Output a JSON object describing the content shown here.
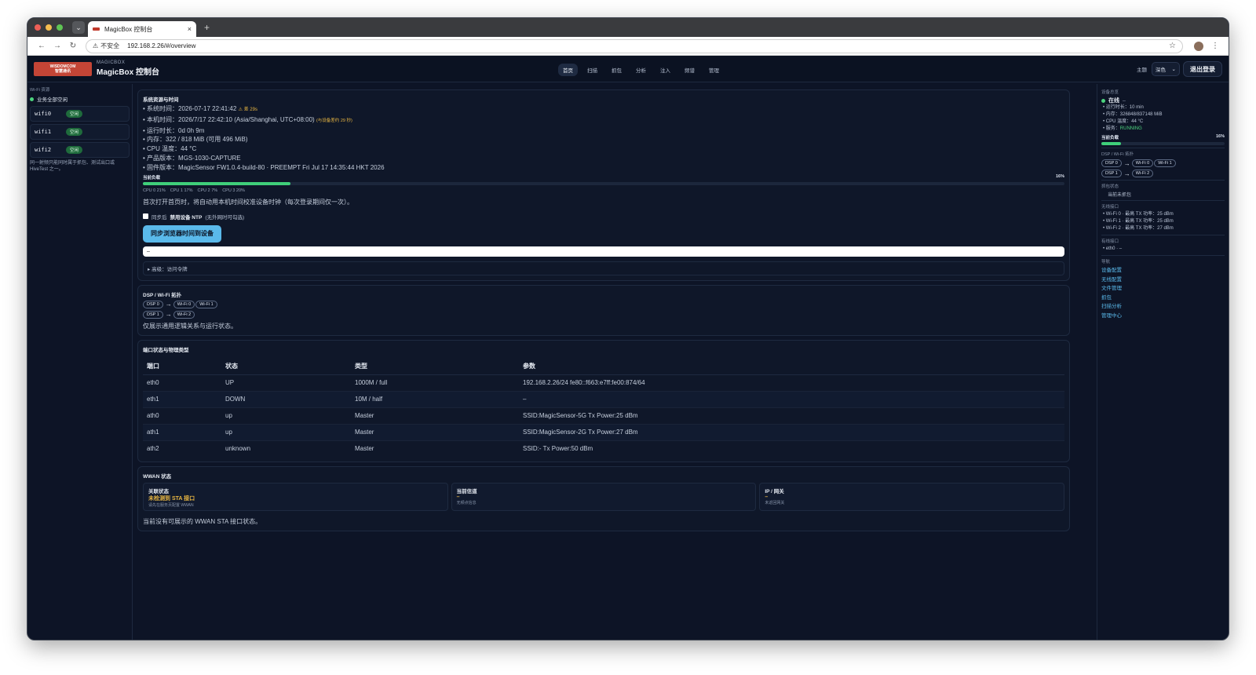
{
  "browser": {
    "tab_title": "MagicBox 控制台",
    "tab_close": "×",
    "new_tab": "+",
    "insecure_label": "不安全",
    "url": "192.168.2.26/#/overview"
  },
  "header": {
    "logo_text_1": "WISDOMCOM",
    "logo_text_2": "智慧通讯",
    "brand_small": "MAGICBOX",
    "brand_title": "MagicBox 控制台",
    "nav": [
      "首页",
      "扫描",
      "抓包",
      "分析",
      "注入",
      "频谱",
      "管理"
    ],
    "active_nav": 0,
    "theme_label": "主题",
    "theme_value": "深色",
    "logout_label": "退出登录"
  },
  "left_sidebar": {
    "title": "Wi-Fi 资源",
    "all_idle": "业务全部空闲",
    "items": [
      {
        "name": "wifi0",
        "status": "空闲"
      },
      {
        "name": "wifi1",
        "status": "空闲"
      },
      {
        "name": "wifi2",
        "status": "空闲"
      }
    ],
    "note": "同一射频只能同时属于抓包、测试出口或 HiveTest 之一。"
  },
  "system": {
    "title": "系统资源与时间",
    "system_time": "系统时间：2026-07-17 22:41:42",
    "time_diff": "⚠ 差 29s",
    "local_time": "本机时间：2026/7/17 22:42:10 (Asia/Shanghai, UTC+08:00)",
    "local_hint": "(与设备差约 29 秒)",
    "uptime": "运行时长：0d 0h 9m",
    "memory": "内存：322 / 818 MiB (可用 496 MiB)",
    "cpu_temp": "CPU 温度：44 °C",
    "product": "产品版本：MGS-1030-CAPTURE",
    "firmware": "固件版本：MagicSensor FW1.0.4-build-80 · PREEMPT Fri Jul 17 14:35:44 HKT 2026",
    "load_label": "当前负载",
    "load_percent": "16%",
    "load_fraction": 0.16,
    "cpus": [
      "CPU 0 21%",
      "CPU 1 17%",
      "CPU 2 7%",
      "CPU 3 20%"
    ],
    "note": "首次打开首页时，将自动用本机时间校准设备时钟（每次登录期间仅一次）。",
    "checkbox_prefix": "同步后",
    "checkbox_bold": "禁用设备 NTP",
    "checkbox_suffix": "(无外网时可勾选)",
    "sync_button": "同步浏览器时间到设备",
    "output_value": "–",
    "advanced": "▸ 高级：访问令牌"
  },
  "topology": {
    "title": "DSP / Wi-Fi 拓扑",
    "rows": [
      {
        "dsp": "DSP 0",
        "wifi": [
          "Wi-Fi 0",
          "Wi-Fi 1"
        ]
      },
      {
        "dsp": "DSP 1",
        "wifi": [
          "Wi-Fi 2"
        ]
      }
    ],
    "arrow": "→",
    "note": "仅展示通用逻辑关系与运行状态。"
  },
  "ports": {
    "title": "端口状态与物理类型",
    "columns": [
      "端口",
      "状态",
      "类型",
      "参数"
    ],
    "rows": [
      [
        "eth0",
        "UP",
        "1000M / full",
        "192.168.2.26/24 fe80::f663:e7ff:fe00:874/64"
      ],
      [
        "eth1",
        "DOWN",
        "10M / half",
        "–"
      ],
      [
        "ath0",
        "up",
        "Master",
        "SSID:MagicSensor-5G Tx Power:25 dBm"
      ],
      [
        "ath1",
        "up",
        "Master",
        "SSID:MagicSensor-2G Tx Power:27 dBm"
      ],
      [
        "ath2",
        "unknown",
        "Master",
        "SSID:- Tx Power:50 dBm"
      ]
    ]
  },
  "wwan": {
    "title": "WWAN 状态",
    "cards": [
      {
        "label": "关联状态",
        "value": "未检测到 STA 接口",
        "sub": "请先在服务页配置 WWAN"
      },
      {
        "label": "当前信道",
        "value": "–",
        "sub": "无频点信息"
      },
      {
        "label": "IP / 网关",
        "value": "–",
        "sub": "未返回网关"
      }
    ],
    "note": "当前没有可展示的 WWAN STA 接口状态。"
  },
  "right_sidebar": {
    "device_title": "设备总览",
    "online": "在线",
    "online_suffix": "–",
    "stats": [
      "运行时长：10 min",
      "内存：326848/837148 MiB",
      "CPU 温度：44 °C"
    ],
    "service_label": "服务：",
    "service_value": "RUNNING",
    "load_label": "当前负载",
    "load_percent": "16%",
    "load_fraction": 0.16,
    "topo_title": "DSP / Wi-Fi 拓扑",
    "capture_title": "抓包状态",
    "capture_text": "当前未抓包",
    "wireless_title": "无线接口",
    "wireless": [
      "Wi-Fi 0 · 最高 TX 功率：25 dBm",
      "Wi-Fi 1 · 最高 TX 功率：25 dBm",
      "Wi-Fi 2 · 最高 TX 功率：27 dBm"
    ],
    "wired_title": "有线接口",
    "wired": [
      "eth0 · –"
    ],
    "nav_title": "导航",
    "links": [
      "设备配置",
      "无线配置",
      "文件管理",
      "抓包",
      "扫描分析",
      "管理中心"
    ]
  },
  "colors": {
    "accent": "#5ab9ea",
    "ok": "#3fcf7a",
    "warn": "#e8b642",
    "background": "#0d1426"
  }
}
